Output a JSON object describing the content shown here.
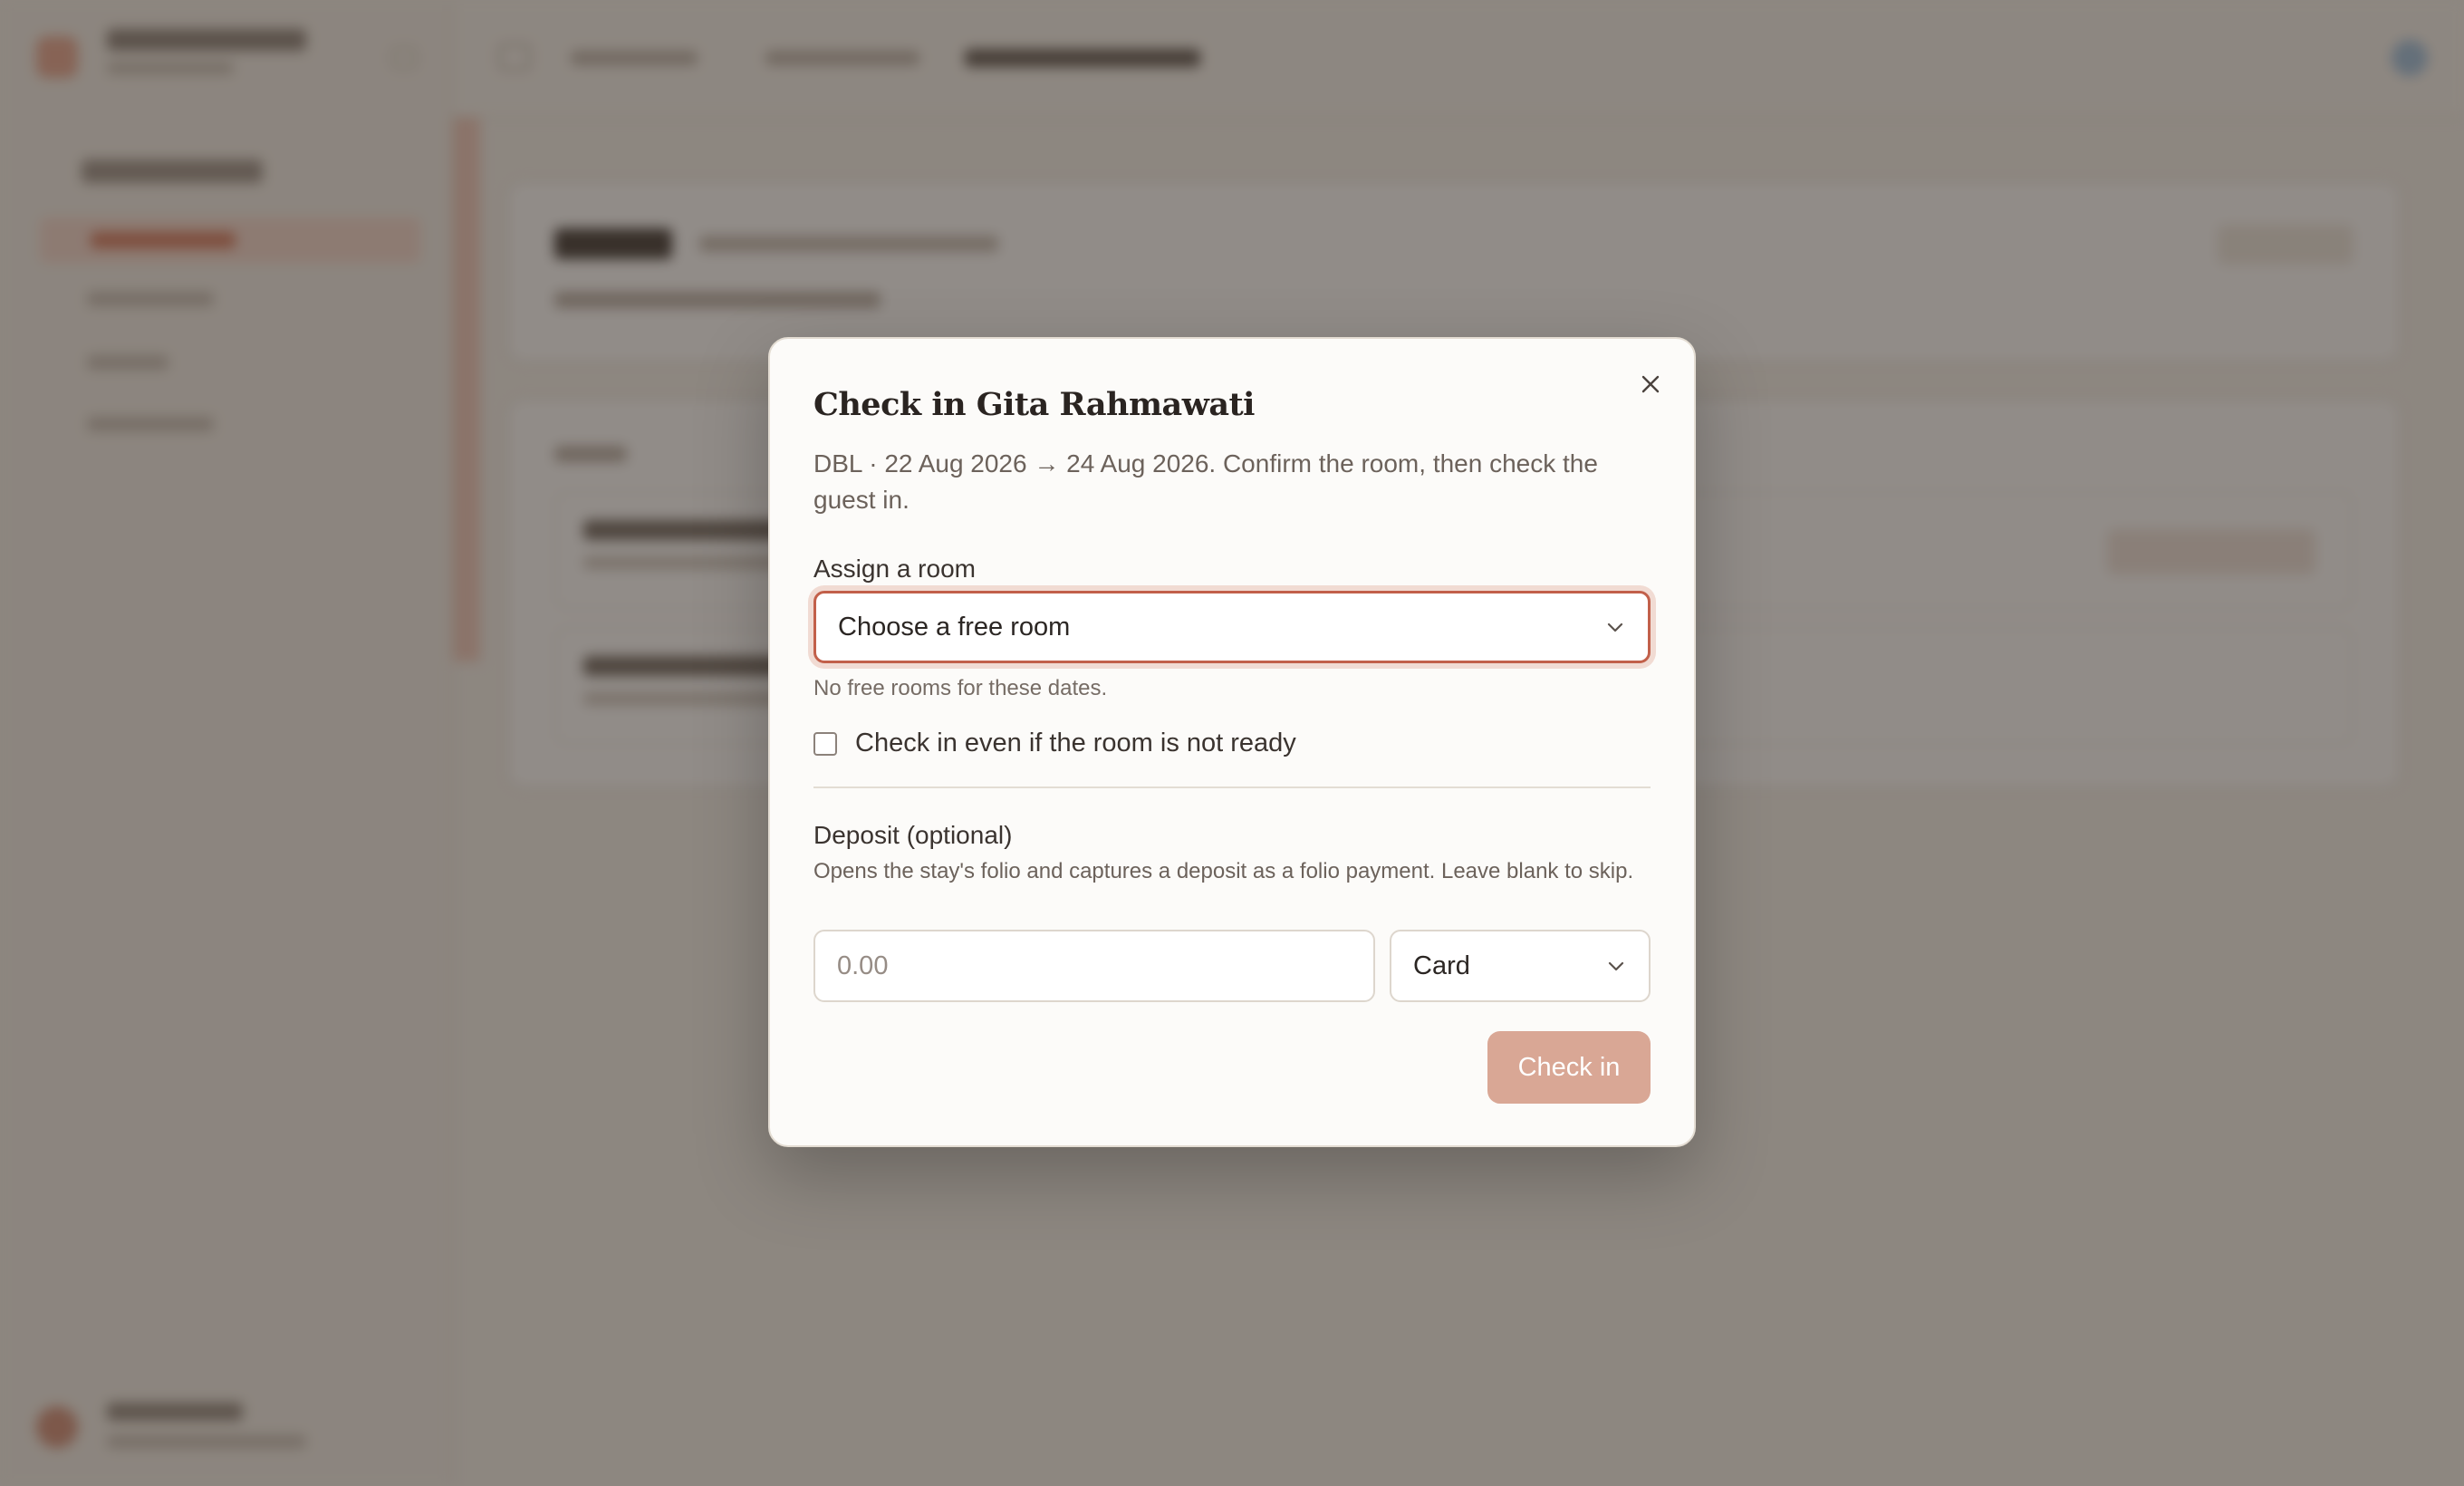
{
  "modal": {
    "title": "Check in Gita Rahmawati",
    "description": "DBL · 22 Aug 2026 → 24 Aug 2026. Confirm the room, then check the guest in.",
    "room": {
      "label": "Assign a room",
      "selected": "Choose a free room",
      "helper": "No free rooms for these dates."
    },
    "override_checkbox": {
      "label": "Check in even if the room is not ready",
      "checked": false
    },
    "deposit": {
      "label": "Deposit (optional)",
      "description": "Opens the stay's folio and captures a deposit as a folio payment. Leave blank to skip.",
      "amount_placeholder": "0.00",
      "method_selected": "Card"
    },
    "submit_label": "Check in",
    "close_icon": "close-icon"
  },
  "colors": {
    "accent": "#c2604a",
    "submit_disabled": "#d9a795",
    "overlay": "#372d26"
  }
}
